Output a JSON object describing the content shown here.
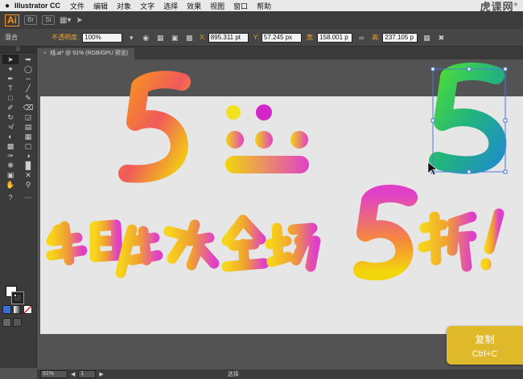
{
  "menubar": {
    "apple": "",
    "app_name": "Illustrator CC",
    "items": [
      "文件",
      "编辑",
      "对象",
      "文字",
      "选择",
      "效果",
      "视图",
      "窗口",
      "帮助"
    ],
    "watermark": "虎课网",
    "watermark_reg": "®"
  },
  "appbar": {
    "logo": "Ai",
    "br_button": "Br",
    "st_button": "St"
  },
  "controlbar": {
    "blend_label": "混合",
    "opacity_label": "不透明度:",
    "opacity_value": "100%",
    "x_label": "X:",
    "x_value": "895.311 pt",
    "y_label": "Y:",
    "y_value": "57.245 px",
    "w_label": "宽:",
    "w_value": "158.001 p",
    "h_label": "高:",
    "h_value": "237.105 p"
  },
  "document": {
    "tab_label": "线.ai* @ 91% (RGB/GPU 预览)"
  },
  "statusbar": {
    "zoom": "91%",
    "page": "1",
    "status": "选择"
  },
  "overlay": {
    "title": "复制",
    "shortcut": "Ctrl+C"
  },
  "colors": {
    "orange": "#f7931e",
    "yellow": "#f2d60c",
    "magenta": "#e040c8",
    "green": "#2cc55a",
    "overlay": "#e0b92a"
  }
}
